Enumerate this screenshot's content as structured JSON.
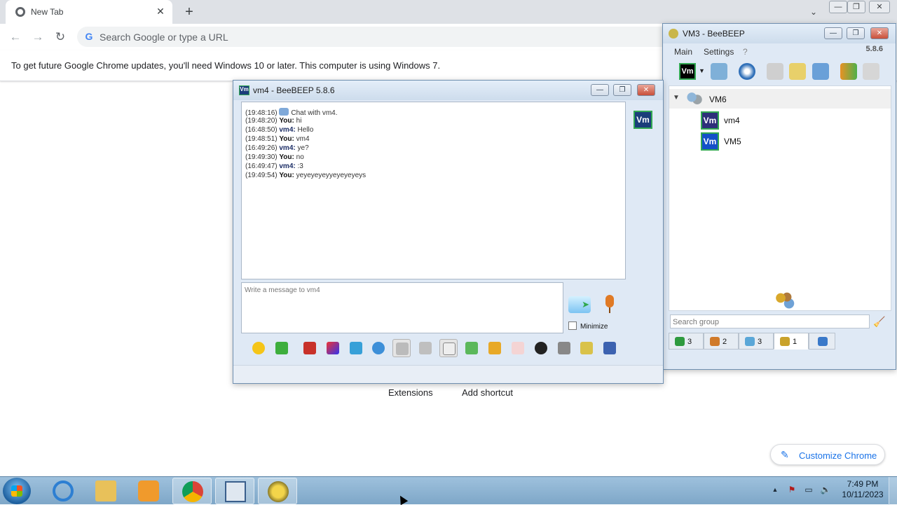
{
  "chrome": {
    "tab_title": "New Tab",
    "tab_close": "✕",
    "new_tab": "+",
    "tab_search": "⌄",
    "window_controls": {
      "minimize": "—",
      "restore": "❐",
      "close": "✕"
    },
    "nav": {
      "back": "←",
      "forward": "→",
      "reload": "↻"
    },
    "omnibox_g": "G",
    "omnibox_placeholder": "Search Google or type a URL",
    "infobar_text": "To get future Google Chrome updates, you'll need Windows 10 or later. This computer is using Windows 7.",
    "shortcuts": {
      "extensions": "Extensions",
      "add_shortcut": "Add shortcut"
    },
    "customize_label": "Customize Chrome",
    "customize_icon": "✎"
  },
  "chat_window": {
    "title": "vm4 - BeeBEEP 5.8.6",
    "title_icon": "Vm",
    "caption": {
      "minimize": "—",
      "maximize": "❐",
      "close": "✕"
    },
    "lines": [
      {
        "time": "(19:48:16)",
        "who": "",
        "text": "Chat with vm4."
      },
      {
        "time": "(19:48:20)",
        "who": "You:",
        "text": "hi"
      },
      {
        "time": "(16:48:50)",
        "who": "vm4:",
        "text": "Hello"
      },
      {
        "time": "(19:48:51)",
        "who": "You:",
        "text": "vm4"
      },
      {
        "time": "(16:49:26)",
        "who": "vm4:",
        "text": "ye?"
      },
      {
        "time": "(19:49:30)",
        "who": "You:",
        "text": "no"
      },
      {
        "time": "(16:49:47)",
        "who": "vm4:",
        "text": ":3"
      },
      {
        "time": "(19:49:54)",
        "who": "You:",
        "text": "yeyeyeyeyyeyeyeyeys"
      }
    ],
    "side_avatar": "Vm",
    "input_placeholder": "Write a message to vm4",
    "minimize_label": "Minimize",
    "tools": [
      "emoticons-icon",
      "save-icon",
      "font-icon",
      "color-icon",
      "filter-icon",
      "settings-icon",
      "spellcheck-icon",
      "word-complete-icon",
      "enter-send-icon",
      "send-file-icon",
      "send-folder-icon",
      "html-icon",
      "screenshot-icon",
      "history-icon",
      "edit-icon",
      "save-chat-icon"
    ]
  },
  "main_window": {
    "title": "VM3 - BeeBEEP",
    "caption": {
      "minimize": "—",
      "maximize": "❐",
      "close": "✕"
    },
    "menu": {
      "main": "Main",
      "settings": "Settings",
      "help": "?"
    },
    "version": "5.8.6",
    "self_avatar": "Vm",
    "group_name": "VM6",
    "group_arrow": "▼",
    "users": [
      {
        "name": "vm4",
        "avatar": "Vm"
      },
      {
        "name": "VM5",
        "avatar": "Vm"
      }
    ],
    "search_placeholder": "Search group",
    "broom_icon": "🧹",
    "tabs": [
      {
        "count": "3",
        "icon": "users-tab-icon",
        "color": "#2e9a3e"
      },
      {
        "count": "2",
        "icon": "groups-tab-icon",
        "color": "#d07a2a"
      },
      {
        "count": "3",
        "icon": "chats-tab-icon",
        "color": "#5aa7d8"
      },
      {
        "count": "1",
        "icon": "group-members-tab-icon",
        "color": "#c9a22b"
      },
      {
        "count": "",
        "icon": "plugin-tab-icon",
        "color": "#3a79c9"
      }
    ]
  },
  "taskbar": {
    "apps": [
      "internet-explorer-icon",
      "file-explorer-icon",
      "media-player-icon",
      "chrome-icon",
      "remote-desktop-icon",
      "beebeep-icon"
    ],
    "tray": {
      "arrow": "▲",
      "flag": "⚑",
      "network": "▭",
      "volume": "🔈"
    },
    "time": "7:49 PM",
    "date": "10/11/2023"
  },
  "colors": {
    "chrome_tabstrip": "#dee1e6",
    "beebeep_frame": "#dfe9f5",
    "vm_avatar": "#1a3d7a",
    "vm_border": "#32a852",
    "taskbar": "#8fb5d5"
  }
}
